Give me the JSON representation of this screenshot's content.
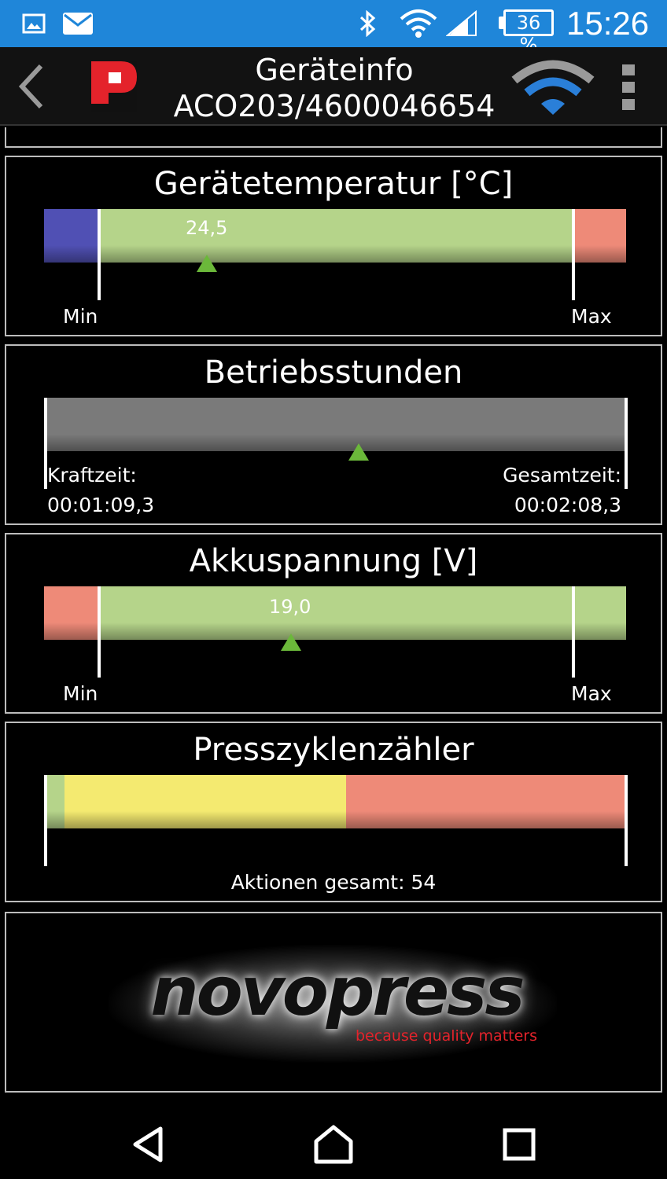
{
  "status_bar": {
    "battery_text": "36 %",
    "clock": "15:26",
    "icons": [
      "image-icon",
      "mail-icon",
      "bluetooth-icon",
      "wifi-icon",
      "signal-icon",
      "battery-icon"
    ]
  },
  "header": {
    "title": "Geräteinfo",
    "subtitle": "ACO203/4600046654",
    "icons": [
      "back-icon",
      "app-logo",
      "wifi-connection-icon",
      "overflow-menu-icon"
    ]
  },
  "cards": {
    "temperature": {
      "title": "Gerätetemperatur [°C]",
      "value": "24,5",
      "min_label": "Min",
      "max_label": "Max"
    },
    "operating_hours": {
      "title": "Betriebsstunden",
      "left_label": "Kraftzeit:",
      "left_value": "00:01:09,3",
      "right_label": "Gesamtzeit:",
      "right_value": "00:02:08,3"
    },
    "battery_voltage": {
      "title": "Akkuspannung [V]",
      "value": "19,0",
      "min_label": "Min",
      "max_label": "Max"
    },
    "press_cycles": {
      "title": "Presszyklenzähler",
      "total_label": "Aktionen gesamt: 54"
    }
  },
  "brand": {
    "name": "novopress",
    "tagline": "because quality matters"
  },
  "colors": {
    "status_bar": "#1f86d9",
    "bar_green": "#b5d48a",
    "bar_blue": "#5050b4",
    "bar_red": "#ee8a78",
    "bar_gray": "#7a7a7a",
    "bar_yellow": "#f4ea70",
    "marker": "#6bb83a",
    "brand_red": "#e4232b"
  },
  "nav_bar": {
    "icons": [
      "back-triangle-icon",
      "home-icon",
      "recents-icon"
    ]
  }
}
